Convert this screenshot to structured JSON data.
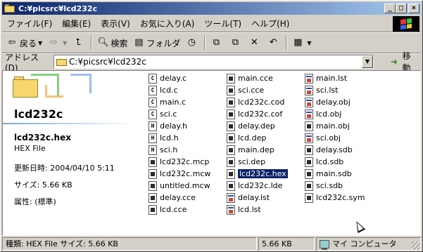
{
  "window": {
    "title": "C:¥picsrc¥lcd232c",
    "min": "_",
    "max": "□",
    "close": "×"
  },
  "menu": [
    "ファイル(F)",
    "編集(E)",
    "表示(V)",
    "お気に入り(A)",
    "ツール(T)",
    "ヘルプ(H)"
  ],
  "toolbar": {
    "back": "戻る",
    "search": "検索",
    "folders": "フォルダ"
  },
  "address": {
    "label": "アドレス(D)",
    "value": "C:¥picsrc¥lcd232c",
    "go": "移動"
  },
  "left_pane": {
    "folder_title": "lcd232c",
    "selected_name": "lcd232c.hex",
    "selected_type": "HEX File",
    "modified": "更新日時: 2004/04/10 5:11",
    "size": "サイズ: 5.66 KB",
    "attributes": "属性: (標準)"
  },
  "files": {
    "col1": [
      {
        "name": "delay.c",
        "icon": "c"
      },
      {
        "name": "lcd.c",
        "icon": "c"
      },
      {
        "name": "main.c",
        "icon": "c"
      },
      {
        "name": "sci.c",
        "icon": "c"
      },
      {
        "name": "delay.h",
        "icon": "h"
      },
      {
        "name": "lcd.h",
        "icon": "h"
      },
      {
        "name": "sci.h",
        "icon": "h"
      },
      {
        "name": "lcd232c.mcp",
        "icon": "gen"
      },
      {
        "name": "lcd232c.mcw",
        "icon": "gen"
      },
      {
        "name": "untitled.mcw",
        "icon": "gen"
      },
      {
        "name": "delay.cce",
        "icon": "gen"
      },
      {
        "name": "lcd.cce",
        "icon": "gen"
      }
    ],
    "col2": [
      {
        "name": "main.cce",
        "icon": "gen"
      },
      {
        "name": "sci.cce",
        "icon": "gen"
      },
      {
        "name": "lcd232c.cod",
        "icon": "gen"
      },
      {
        "name": "lcd232c.cof",
        "icon": "gen"
      },
      {
        "name": "delay.dep",
        "icon": "gen"
      },
      {
        "name": "lcd.dep",
        "icon": "gen"
      },
      {
        "name": "main.dep",
        "icon": "gen"
      },
      {
        "name": "sci.dep",
        "icon": "gen"
      },
      {
        "name": "lcd232c.hex",
        "icon": "gen",
        "selected": true
      },
      {
        "name": "lcd232c.lde",
        "icon": "gen"
      },
      {
        "name": "delay.lst",
        "icon": "win"
      },
      {
        "name": "lcd.lst",
        "icon": "win"
      }
    ],
    "col3": [
      {
        "name": "main.lst",
        "icon": "win"
      },
      {
        "name": "sci.lst",
        "icon": "win"
      },
      {
        "name": "delay.obj",
        "icon": "win"
      },
      {
        "name": "lcd.obj",
        "icon": "win"
      },
      {
        "name": "main.obj",
        "icon": "gen"
      },
      {
        "name": "sci.obj",
        "icon": "win"
      },
      {
        "name": "delay.sdb",
        "icon": "gen"
      },
      {
        "name": "lcd.sdb",
        "icon": "gen"
      },
      {
        "name": "main.sdb",
        "icon": "gen"
      },
      {
        "name": "sci.sdb",
        "icon": "gen"
      },
      {
        "name": "lcd232c.sym",
        "icon": "gen"
      }
    ]
  },
  "status": {
    "info": "種類: HEX File サイズ: 5.66 KB",
    "size": "5.66 KB",
    "location": "マイ コンピュータ"
  }
}
